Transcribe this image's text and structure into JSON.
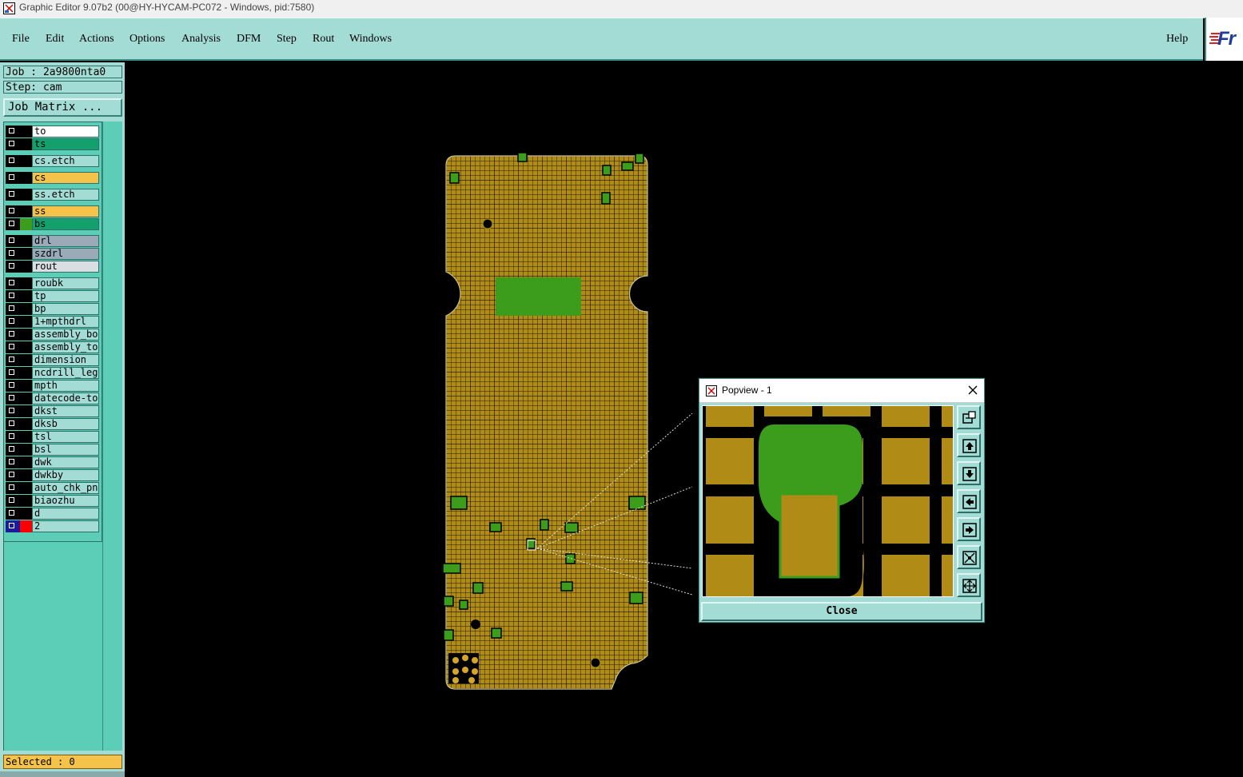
{
  "window": {
    "title": "Graphic Editor 9.07b2 (00@HY-HYCAM-PC072 - Windows, pid:7580)"
  },
  "menu": {
    "items": [
      "File",
      "Edit",
      "Actions",
      "Options",
      "Analysis",
      "DFM",
      "Step",
      "Rout",
      "Windows"
    ],
    "help": "Help",
    "logo_text": "Fr"
  },
  "info": {
    "job": "Job : 2a9800nta0",
    "step": "Step: cam",
    "job_matrix": "Job Matrix ..."
  },
  "layers": [
    {
      "name": "to",
      "bg": "#ffffff",
      "swatch": "#000000"
    },
    {
      "name": "ts",
      "bg": "#13a06c",
      "swatch": "#000000"
    },
    {
      "name": "cs.etch",
      "bg": "#a3dcd4",
      "swatch": "#000000"
    },
    {
      "name": "cs",
      "bg": "#f5c24a",
      "swatch": "#000000"
    },
    {
      "name": "ss.etch",
      "bg": "#a3dcd4",
      "swatch": "#000000"
    },
    {
      "name": "ss",
      "bg": "#f5c24a",
      "swatch": "#000000"
    },
    {
      "name": "bs",
      "bg": "#13a06c",
      "swatch": "#3c9c1c"
    },
    {
      "name": "drl",
      "bg": "#9aaab8",
      "swatch": "#000000"
    },
    {
      "name": "szdrl",
      "bg": "#9aaab8",
      "swatch": "#000000"
    },
    {
      "name": "rout",
      "bg": "#d9dee2",
      "swatch": "#000000"
    },
    {
      "name": "roubk",
      "bg": "#a3dcd4",
      "swatch": "#000000"
    },
    {
      "name": "tp",
      "bg": "#a3dcd4",
      "swatch": "#000000"
    },
    {
      "name": "bp",
      "bg": "#a3dcd4",
      "swatch": "#000000"
    },
    {
      "name": "1+mpthdrl",
      "bg": "#a3dcd4",
      "swatch": "#000000"
    },
    {
      "name": "assembly_bot",
      "bg": "#a3dcd4",
      "swatch": "#000000"
    },
    {
      "name": "assembly_top",
      "bg": "#a3dcd4",
      "swatch": "#000000"
    },
    {
      "name": "dimension",
      "bg": "#a3dcd4",
      "swatch": "#000000"
    },
    {
      "name": "ncdrill_legend",
      "bg": "#a3dcd4",
      "swatch": "#000000"
    },
    {
      "name": "mpth",
      "bg": "#a3dcd4",
      "swatch": "#000000"
    },
    {
      "name": "datecode-to",
      "bg": "#a3dcd4",
      "swatch": "#000000"
    },
    {
      "name": "dkst",
      "bg": "#a3dcd4",
      "swatch": "#000000"
    },
    {
      "name": "dksb",
      "bg": "#a3dcd4",
      "swatch": "#000000"
    },
    {
      "name": "tsl",
      "bg": "#a3dcd4",
      "swatch": "#000000"
    },
    {
      "name": "bsl",
      "bg": "#a3dcd4",
      "swatch": "#000000"
    },
    {
      "name": "dwk",
      "bg": "#a3dcd4",
      "swatch": "#000000"
    },
    {
      "name": "dwkby",
      "bg": "#a3dcd4",
      "swatch": "#000000"
    },
    {
      "name": "auto_chk_pnl",
      "bg": "#a3dcd4",
      "swatch": "#000000"
    },
    {
      "name": "biaozhu",
      "bg": "#a3dcd4",
      "swatch": "#000000"
    },
    {
      "name": "d",
      "bg": "#a3dcd4",
      "swatch": "#000000"
    },
    {
      "name": "2",
      "bg": "#a3dcd4",
      "swatch": "#ff0000"
    }
  ],
  "status": {
    "selected": "Selected : 0"
  },
  "popview": {
    "title": "Popview - 1",
    "close_label": "Close",
    "buttons": [
      "zoom-home-icon",
      "pan-up-icon",
      "pan-down-icon",
      "pan-left-icon",
      "pan-right-icon",
      "zoom-out-icon",
      "fit-view-icon"
    ]
  },
  "colors": {
    "copper": "#b08c16",
    "mask_green": "#3c9c1c",
    "panel": "#a3dcd4",
    "layer_area": "#5ccdb7",
    "highlight_red": "#ff0000"
  }
}
